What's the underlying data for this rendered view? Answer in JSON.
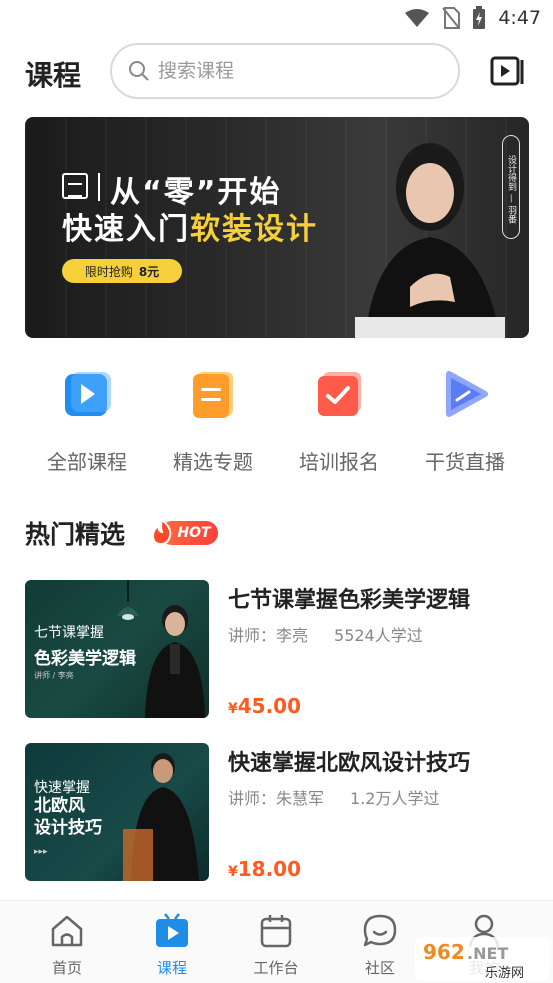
{
  "status_bar": {
    "time": "4:47",
    "icons": [
      "wifi-icon",
      "no-sim-icon",
      "battery-charging-icon"
    ]
  },
  "header": {
    "title": "课程",
    "search_placeholder": "搜索课程",
    "right_icon": "video-library-icon"
  },
  "banner": {
    "line1": "从“零”开始",
    "line2_white": "快速入门",
    "line2_yellow": "软装设计",
    "promo_label": "限时抢购",
    "promo_price": "8元",
    "vertical_tag": "设计得到 — 羽番"
  },
  "quick_nav": [
    {
      "label": "全部课程",
      "icon": "play-square-icon",
      "color": "#1e8ff0"
    },
    {
      "label": "精选专题",
      "icon": "document-icon",
      "color": "#ff9c2a"
    },
    {
      "label": "培训报名",
      "icon": "check-square-icon",
      "color": "#ff5b4a"
    },
    {
      "label": "干货直播",
      "icon": "play-triangle-icon",
      "color": "#5b7cf5"
    }
  ],
  "section": {
    "title": "热门精选",
    "badge": "HOT"
  },
  "courses": [
    {
      "title": "七节课掌握色彩美学逻辑",
      "teacher": "讲师：李亮",
      "learners": "5524人学过",
      "price_symbol": "¥",
      "price": "45.00",
      "thumb_line1": "七节课掌握",
      "thumb_line2": "色彩美学逻辑",
      "thumb_line3": "讲师 / 李亮"
    },
    {
      "title": "快速掌握北欧风设计技巧",
      "teacher": "讲师：朱慧军",
      "learners": "1.2万人学过",
      "price_symbol": "¥",
      "price": "18.00",
      "thumb_line1": "快速掌握",
      "thumb_line2": "北欧风\n设计技巧",
      "thumb_line3": "▸▸▸"
    }
  ],
  "tabs": [
    {
      "label": "首页",
      "icon": "home-icon",
      "active": false
    },
    {
      "label": "课程",
      "icon": "tv-play-icon",
      "active": true
    },
    {
      "label": "工作台",
      "icon": "calendar-icon",
      "active": false
    },
    {
      "label": "社区",
      "icon": "chat-bubble-icon",
      "active": false
    },
    {
      "label": "我的",
      "icon": "user-icon",
      "active": false
    }
  ],
  "colors": {
    "accent": "#1f8de6",
    "price": "#ff5a1f",
    "banner_yellow": "#f6d03b"
  },
  "watermark": {
    "text": "962.NET",
    "sub": "乐游网"
  }
}
